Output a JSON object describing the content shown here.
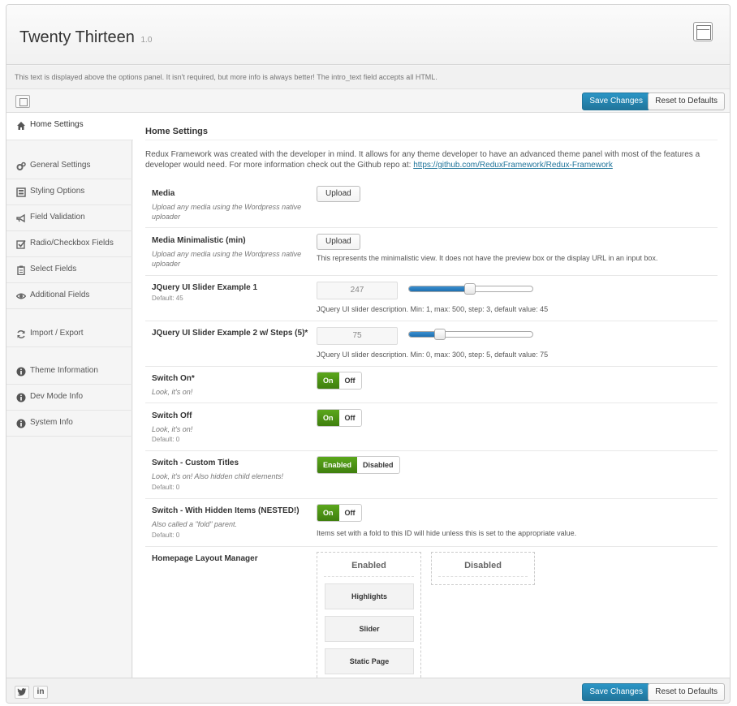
{
  "header": {
    "title": "Twenty Thirteen",
    "version": "1.0",
    "layout_icon": "layout-icon"
  },
  "intro_text": "This text is displayed above the options panel. It isn't required, but more info is always better! The intro_text field accepts all HTML.",
  "toolbar": {
    "save_label": "Save Changes",
    "reset_label": "Reset to Defaults",
    "expand_icon": "expand-icon"
  },
  "sidebar": {
    "items": [
      {
        "label": "Home Settings",
        "icon": "home-icon"
      },
      {
        "label": "General Settings",
        "icon": "cogs-icon"
      },
      {
        "label": "Styling Options",
        "icon": "styling-icon"
      },
      {
        "label": "Field Validation",
        "icon": "bullhorn-icon"
      },
      {
        "label": "Radio/Checkbox Fields",
        "icon": "checkbox-icon"
      },
      {
        "label": "Select Fields",
        "icon": "clipboard-icon"
      },
      {
        "label": "Additional Fields",
        "icon": "eye-icon"
      },
      {
        "label": "Import / Export",
        "icon": "refresh-icon"
      },
      {
        "label": "Theme Information",
        "icon": "info-icon"
      },
      {
        "label": "Dev Mode Info",
        "icon": "info-icon"
      },
      {
        "label": "System Info",
        "icon": "info-icon"
      }
    ]
  },
  "main": {
    "section_title": "Home Settings",
    "section_desc": "Redux Framework was created with the developer in mind. It allows for any theme developer to have an advanced theme panel with most of the features a developer would need. For more information check out the Github repo at:",
    "section_link": "https://github.com/ReduxFramework/Redux-Framework",
    "fields": {
      "media": {
        "label": "Media",
        "sub": "Upload any media using the Wordpress native uploader",
        "button": "Upload"
      },
      "media_min": {
        "label": "Media Minimalistic (min)",
        "sub": "Upload any media using the Wordpress native uploader",
        "button": "Upload",
        "desc": "This represents the minimalistic view. It does not have the preview box or the display URL in an input box."
      },
      "slider1": {
        "label": "JQuery UI Slider Example 1",
        "default": "Default: 45",
        "value": "247",
        "min": 1,
        "max": 500,
        "desc": "JQuery UI slider description. Min: 1, max: 500, step: 3, default value: 45"
      },
      "slider2": {
        "label": "JQuery UI Slider Example 2 w/ Steps (5)*",
        "value": "75",
        "min": 0,
        "max": 300,
        "desc": "JQuery UI slider description. Min: 0, max: 300, step: 5, default value: 75"
      },
      "switch_on": {
        "label": "Switch On*",
        "sub": "Look, it's on!",
        "on": "On",
        "off": "Off"
      },
      "switch_off": {
        "label": "Switch Off",
        "sub": "Look, it's on!",
        "default": "Default: 0",
        "on": "On",
        "off": "Off"
      },
      "switch_custom": {
        "label": "Switch - Custom Titles",
        "sub": "Look, it's on! Also hidden child elements!",
        "default": "Default: 0",
        "on": "Enabled",
        "off": "Disabled"
      },
      "switch_hidden": {
        "label": "Switch - With Hidden Items (NESTED!)",
        "sub": "Also called a \"fold\" parent.",
        "default": "Default: 0",
        "on": "On",
        "off": "Off",
        "desc": "Items set with a fold to this ID will hide unless this is set to the appropriate value."
      },
      "layout": {
        "label": "Homepage Layout Manager",
        "enabled_title": "Enabled",
        "disabled_title": "Disabled",
        "enabled_items": [
          "Highlights",
          "Slider",
          "Static Page"
        ]
      }
    }
  },
  "footer": {
    "twitter_icon": "twitter-icon",
    "linkedin_label": "in",
    "save_label": "Save Changes",
    "reset_label": "Reset to Defaults"
  },
  "colors": {
    "primary": "#21759b",
    "switch_on": "#4a8f14",
    "slider_fill": "#2a80c3"
  }
}
